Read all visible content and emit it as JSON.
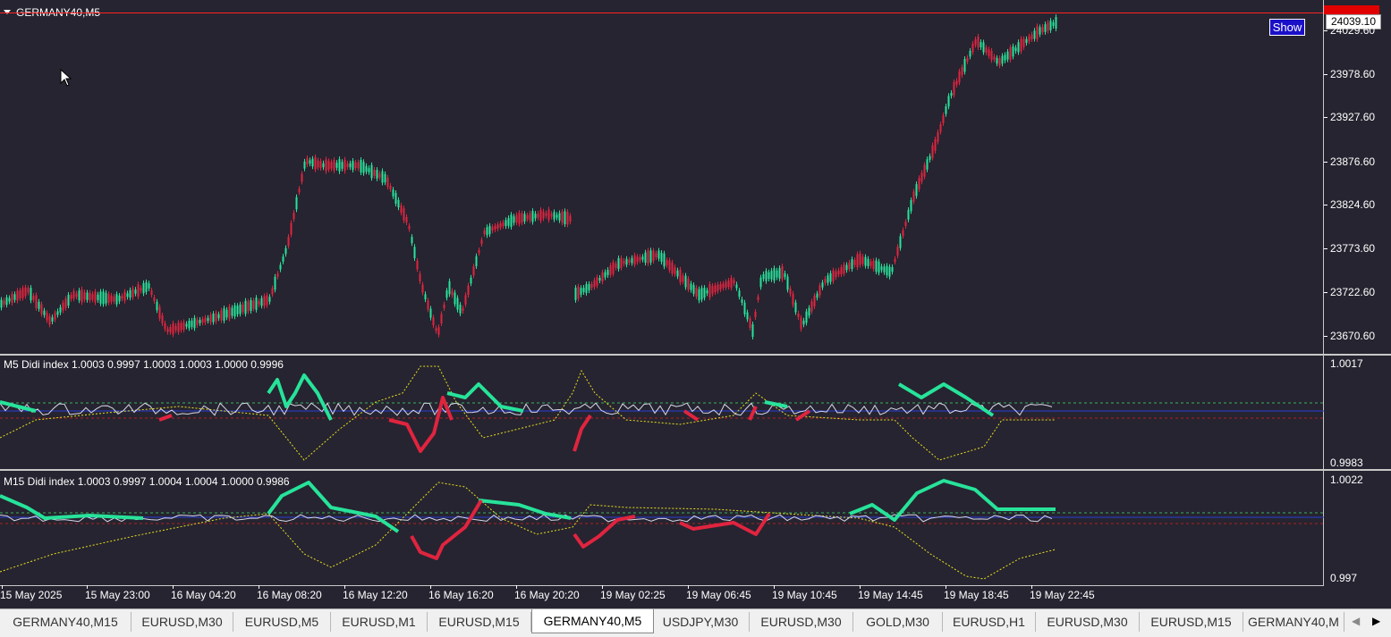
{
  "main": {
    "symbol_label": "GERMANY40,M5",
    "show_button": "Show",
    "current_price": "24039.10",
    "price_axis": [
      "24029.60",
      "23978.60",
      "23927.60",
      "23876.60",
      "23824.60",
      "23773.60",
      "23722.60",
      "23670.60"
    ]
  },
  "indicator1": {
    "label": "M5 Didi index 1.0003 0.9997 1.0003 1.0003 1.0000 0.9996",
    "axis": [
      "1.0017",
      "0.9983"
    ]
  },
  "indicator2": {
    "label": "M15 Didi index 1.0003 0.9997 1.0004 1.0004 1.0000 0.9986",
    "axis": [
      "1.0022",
      "0.997"
    ]
  },
  "time_axis": [
    "15 May 2025",
    "15 May 23:00",
    "16 May 04:20",
    "16 May 08:20",
    "16 May 12:20",
    "16 May 16:20",
    "16 May 20:20",
    "19 May 02:25",
    "19 May 06:45",
    "19 May 10:45",
    "19 May 14:45",
    "19 May 18:45",
    "19 May 22:45"
  ],
  "tabs": [
    "GERMANY40,M15",
    "EURUSD,M30",
    "EURUSD,M5",
    "EURUSD,M1",
    "EURUSD,M15",
    "GERMANY40,M5",
    "USDJPY,M30",
    "EURUSD,M30",
    "GOLD,M30",
    "EURUSD,H1",
    "EURUSD,M30",
    "EURUSD,M15",
    "GERMANY40,M"
  ],
  "active_tab": "GERMANY40,M5",
  "colors": {
    "background": "#262430",
    "bull": "#27e39a",
    "bear": "#e0243f",
    "price_line": "#ff2222",
    "dotted": "#e8e020"
  }
}
